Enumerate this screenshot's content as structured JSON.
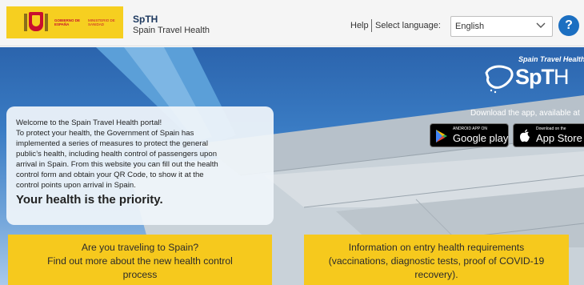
{
  "header": {
    "gov_logo": {
      "left_text": "GOBIERNO DE ESPAÑA",
      "right_text": "MINISTERIO DE SANIDAD",
      "emblem_icon": "spain-coat-of-arms-icon"
    },
    "brand_short": "SpTH",
    "brand_full": "Spain Travel Health",
    "help_label": "Help",
    "select_language_label": "Select language:",
    "language_value": "English",
    "help_button_label": "?"
  },
  "hero": {
    "logo": {
      "subtitle": "Spain Travel Health",
      "acronym_bold": "SpT",
      "acronym_light": "H"
    },
    "download_text": "Download the app, available at",
    "stores": [
      {
        "small": "ANDROID APP ON",
        "big": "Google play",
        "icon": "google-play-icon"
      },
      {
        "small": "Download on the",
        "big": "App Store",
        "icon": "apple-icon"
      }
    ],
    "welcome": {
      "lines": [
        "Welcome to the Spain Travel Health portal!",
        "To protect your health, the Government of Spain has",
        "implemented a series of measures to protect the general",
        "public’s health, including health control of passengers upon",
        "arrival in Spain. From this website you can fill out the health",
        "control form and obtain your QR Code, to show it at the",
        "control points upon arrival in Spain."
      ],
      "emphasis": "Your health is the priority."
    },
    "cards": [
      {
        "lines": [
          "Are you traveling to Spain?",
          "Find out more about the new health control",
          "process"
        ]
      },
      {
        "lines": [
          "Information on entry health requirements",
          "(vaccinations, diagnostic tests, proof of COVID-19",
          "recovery)."
        ]
      }
    ]
  },
  "colors": {
    "accent_yellow": "#f6c91d",
    "help_blue": "#1c6fc1",
    "brand_navy": "#1f3a60",
    "spain_red": "#c8102e"
  }
}
